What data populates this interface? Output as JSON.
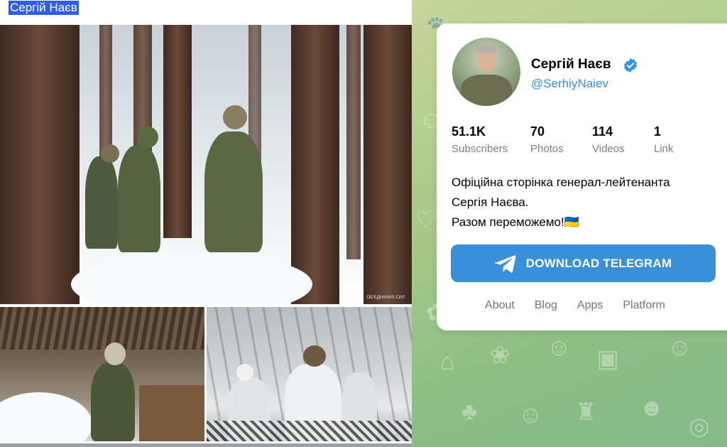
{
  "post": {
    "author": "Сергій Наєв",
    "watermark": "ОБ'ЄДНАНИХ СИЛ"
  },
  "channel": {
    "name": "Сергій Наєв",
    "username": "@SerhiyNaiev",
    "verified": true,
    "stats": [
      {
        "value": "51.1K",
        "label": "Subscribers"
      },
      {
        "value": "70",
        "label": "Photos"
      },
      {
        "value": "114",
        "label": "Videos"
      },
      {
        "value": "1",
        "label": "Link"
      }
    ],
    "description": [
      "Офіційна сторінка генерал-лейтенанта",
      "Сергія Наєва.",
      "Разом переможемо!🇺🇦"
    ],
    "download_label": "DOWNLOAD TELEGRAM",
    "links": [
      "About",
      "Blog",
      "Apps",
      "Platform"
    ]
  },
  "colors": {
    "accent": "#3a8fd9",
    "link": "#3390ec",
    "selection": "#2f5fe0"
  },
  "icons": {
    "verified": "verified-badge-icon",
    "telegram": "telegram-plane-icon"
  }
}
